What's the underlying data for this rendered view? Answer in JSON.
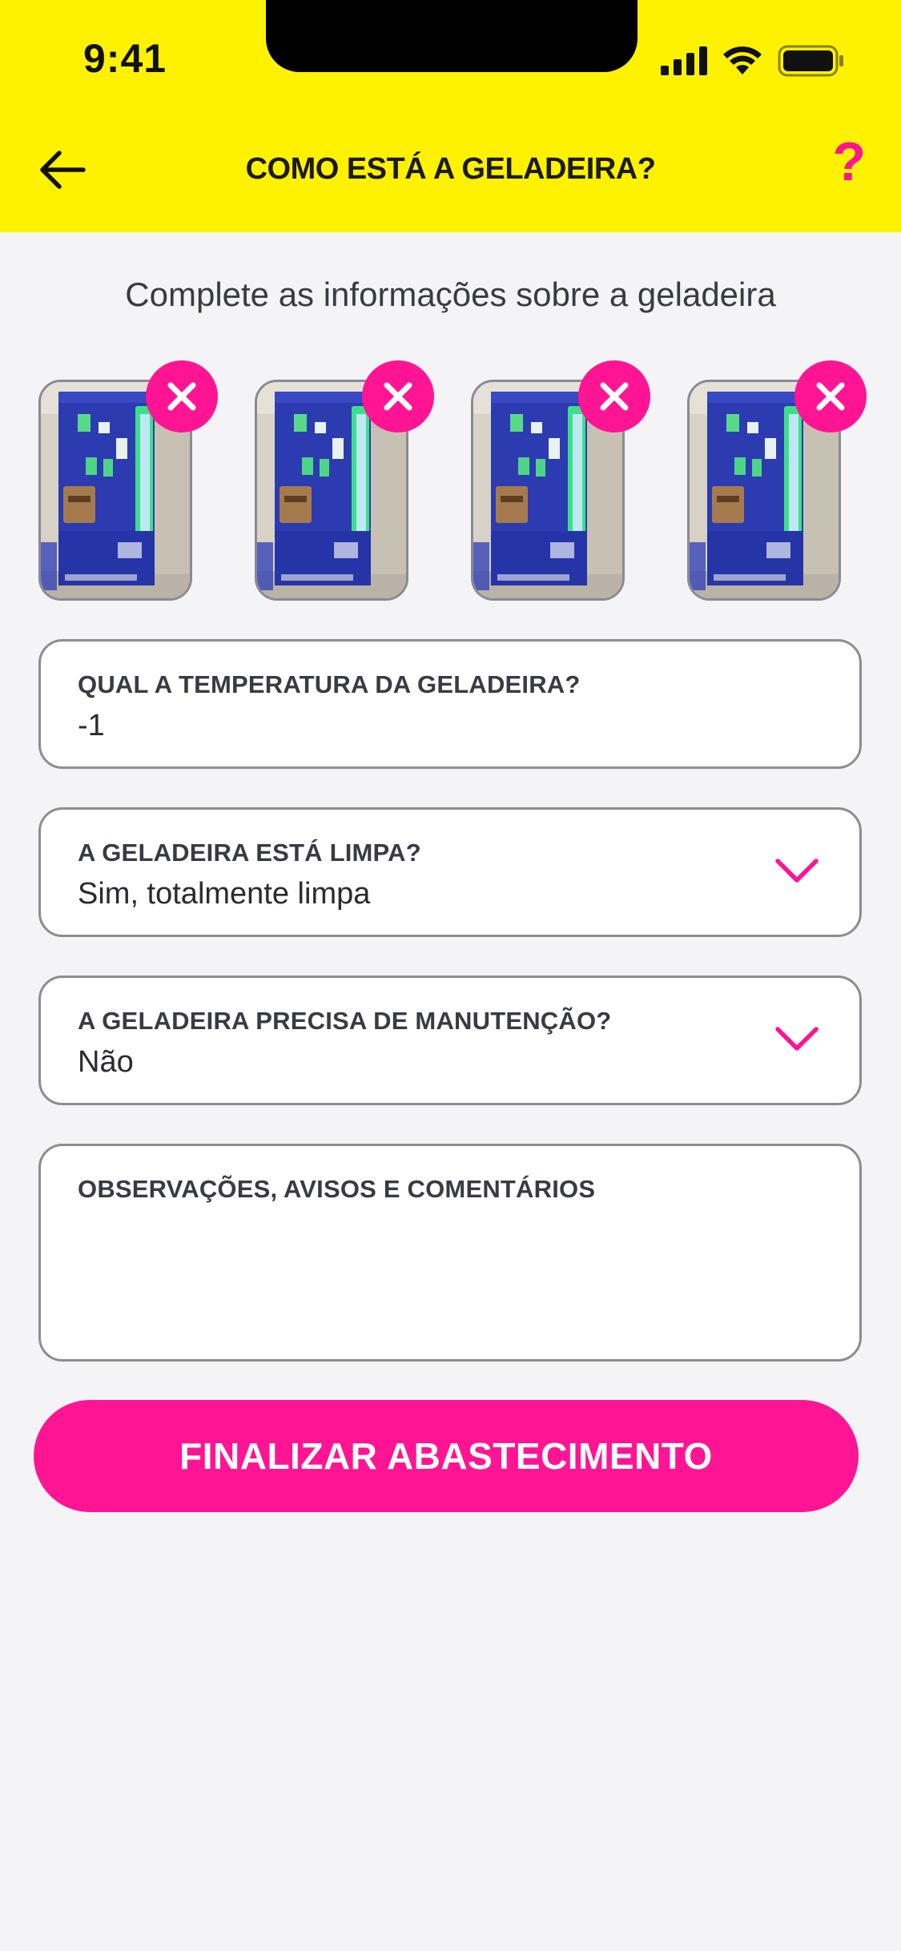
{
  "status_bar": {
    "time": "9:41"
  },
  "header": {
    "title": "COMO ESTÁ A GELADEIRA?",
    "help_label": "?"
  },
  "subtitle": "Complete as informações sobre a geladeira",
  "photos": [
    {
      "name": "fridge-photo-1"
    },
    {
      "name": "fridge-photo-2"
    },
    {
      "name": "fridge-photo-3"
    },
    {
      "name": "fridge-photo-4"
    }
  ],
  "form": {
    "temperature": {
      "label": "QUAL A TEMPERATURA DA GELADEIRA?",
      "value": "-1"
    },
    "clean": {
      "label": "A GELADEIRA ESTÁ LIMPA?",
      "value": "Sim, totalmente limpa"
    },
    "maintenance": {
      "label": "A GELADEIRA PRECISA DE MANUTENÇÃO?",
      "value": "Não"
    },
    "notes": {
      "label": "OBSERVAÇÕES, AVISOS E COMENTÁRIOS",
      "value": ""
    }
  },
  "cta": {
    "label": "FINALIZAR ABASTECIMENTO"
  },
  "colors": {
    "header_bg": "#FFF200",
    "accent": "#FF1493",
    "background": "#F4F4F6"
  }
}
